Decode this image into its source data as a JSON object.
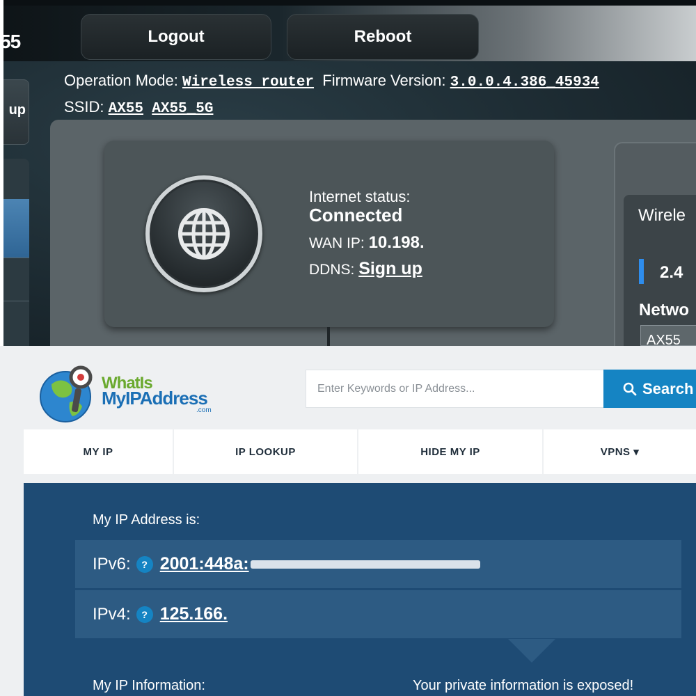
{
  "router": {
    "model_fragment": "55",
    "logout_label": "Logout",
    "reboot_label": "Reboot",
    "side_button_fragment": "up",
    "operation_mode_label": "Operation Mode:",
    "operation_mode_value": "Wireless router",
    "firmware_label": "Firmware Version:",
    "firmware_value": "3.0.0.4.386_45934",
    "ssid_label": "SSID:",
    "ssid_values": [
      "AX55",
      "AX55_5G"
    ],
    "internet_status_label": "Internet status:",
    "internet_status_value": "Connected",
    "wan_ip_label": "WAN IP:",
    "wan_ip_value": "10.198.",
    "ddns_label": "DDNS:",
    "ddns_link": "Sign up",
    "wireless_fragment": "Wirele",
    "band_fragment": "2.4",
    "network_fragment": "Netwo",
    "network_input_fragment": "AX55"
  },
  "site": {
    "logo_line1": "WhatIs",
    "logo_line2": "MyIPAddress",
    "logo_line3": ".com",
    "search_placeholder": "Enter Keywords or IP Address...",
    "search_button": "Search",
    "nav": [
      {
        "label": "MY IP"
      },
      {
        "label": "IP LOOKUP"
      },
      {
        "label": "HIDE MY IP"
      },
      {
        "label": "VPNS ▾"
      }
    ],
    "my_ip_label": "My IP Address is:",
    "ipv6_label": "IPv6:",
    "ipv6_value": "2001:448a:",
    "ipv4_label": "IPv4:",
    "ipv4_value": "125.166.",
    "help_glyph": "?",
    "info_label": "My IP Information:",
    "exposed_text": "Your private information is exposed!"
  },
  "colors": {
    "router_bg": "#1c2a31",
    "router_card": "#4c5558",
    "accent_blue": "#2e8ded",
    "site_blue": "#1e4b74",
    "site_row": "#2d5b83",
    "search_btn": "#1584c3"
  }
}
